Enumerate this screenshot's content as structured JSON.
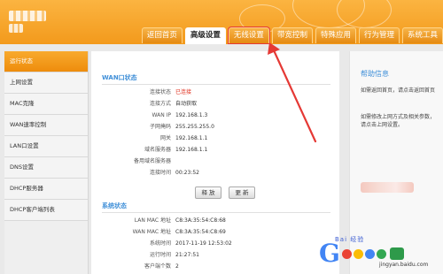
{
  "tabs": [
    {
      "label": "返回首页",
      "active": false
    },
    {
      "label": "高级设置",
      "active": true
    },
    {
      "label": "无线设置",
      "active": false
    },
    {
      "label": "带宽控制",
      "active": false
    },
    {
      "label": "特殊应用",
      "active": false
    },
    {
      "label": "行为管理",
      "active": false
    },
    {
      "label": "系统工具",
      "active": false
    }
  ],
  "sidebar": {
    "items": [
      {
        "label": "运行状态",
        "active": true
      },
      {
        "label": "上网设置"
      },
      {
        "label": "MAC克隆"
      },
      {
        "label": "WAN速率控制"
      },
      {
        "label": "LAN口设置"
      },
      {
        "label": "DNS设置"
      },
      {
        "label": "DHCP服务器"
      },
      {
        "label": "DHCP客户端列表"
      }
    ]
  },
  "wan_status": {
    "title": "WAN口状态",
    "rows": [
      {
        "label": "连接状态",
        "value": "已连接",
        "highlight": true
      },
      {
        "label": "连接方式",
        "value": "自动获取"
      },
      {
        "label": "WAN IP",
        "value": "192.168.1.3"
      },
      {
        "label": "子网掩码",
        "value": "255.255.255.0"
      },
      {
        "label": "网关",
        "value": "192.168.1.1"
      },
      {
        "label": "域名服务器",
        "value": "192.168.1.1"
      },
      {
        "label": "备用域名服务器",
        "value": ""
      },
      {
        "label": "连接时间",
        "value": "00:23:52"
      }
    ],
    "release_label": "释 放",
    "renew_label": "更 新"
  },
  "system_status": {
    "title": "系统状态",
    "rows": [
      {
        "label": "LAN MAC 地址",
        "value": "C8:3A:35:54:C8:68"
      },
      {
        "label": "WAN MAC 地址",
        "value": "C8:3A:35:54:C8:69"
      },
      {
        "label": "系统时间",
        "value": "2017-11-19 12:53:02"
      },
      {
        "label": "运行时间",
        "value": "21:27:51"
      },
      {
        "label": "客户端个数",
        "value": "2"
      }
    ]
  },
  "help": {
    "title": "帮助信息",
    "text1": "如需返回首页，请点击返回首页",
    "text2": "如需修改上网方式及相关参数，请点击上网设置。"
  },
  "watermark": {
    "baidu": "Bai 经验",
    "logo": "G",
    "dot_colors": [
      "#ea4335",
      "#fbbc05",
      "#4285f4",
      "#34a853"
    ],
    "url": "jingyan.baidu.com"
  },
  "colors": {
    "header": "#f39a1c",
    "accent_blue": "#3f8fd8",
    "status_red": "#e0301e",
    "annotation_red": "#e53935"
  }
}
